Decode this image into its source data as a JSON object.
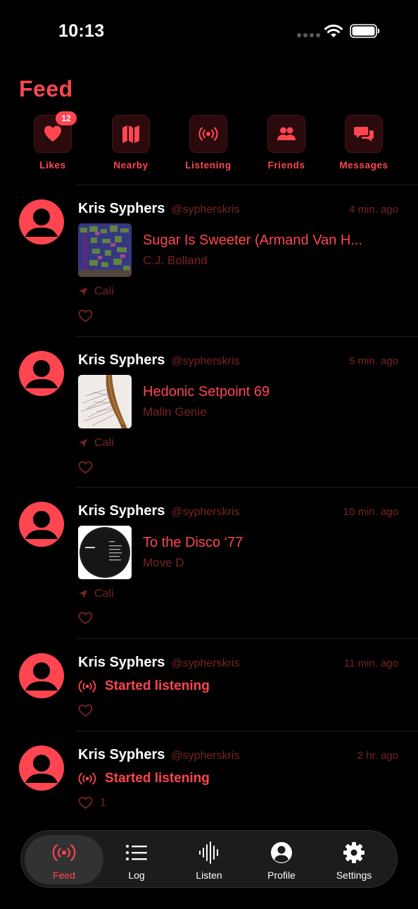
{
  "status_bar": {
    "time": "10:13"
  },
  "title": "Feed",
  "colors": {
    "accent": "#ff4650",
    "muted": "#7a2226",
    "background": "#000000"
  },
  "quick_actions": [
    {
      "label": "Likes",
      "icon": "heart-icon",
      "badge": "12"
    },
    {
      "label": "Nearby",
      "icon": "map-icon"
    },
    {
      "label": "Listening",
      "icon": "broadcast-icon"
    },
    {
      "label": "Friends",
      "icon": "people-icon"
    },
    {
      "label": "Messages",
      "icon": "chat-bubbles-icon"
    }
  ],
  "feed": [
    {
      "name": "Kris Syphers",
      "handle": "@sypherskris",
      "time": "4 min. ago",
      "track_title": "Sugar Is Sweeter (Armand Van H...",
      "artist": "C.J. Bolland",
      "location": "Cali"
    },
    {
      "name": "Kris Syphers",
      "handle": "@sypherskris",
      "time": "5 min. ago",
      "track_title": "Hedonic Setpoint 69",
      "artist": "Malin Genie",
      "location": "Cali"
    },
    {
      "name": "Kris Syphers",
      "handle": "@sypherskris",
      "time": "10 min. ago",
      "track_title": "To the Disco ‘77",
      "artist": "Move D",
      "location": "Cali"
    },
    {
      "name": "Kris Syphers",
      "handle": "@sypherskris",
      "time": "11 min. ago",
      "activity": "Started listening"
    },
    {
      "name": "Kris Syphers",
      "handle": "@sypherskris",
      "time": "2 hr. ago",
      "activity": "Started listening",
      "like_count": "1"
    }
  ],
  "tabs": [
    {
      "label": "Feed",
      "icon": "broadcast-icon",
      "active": true
    },
    {
      "label": "Log",
      "icon": "list-icon"
    },
    {
      "label": "Listen",
      "icon": "waveform-icon"
    },
    {
      "label": "Profile",
      "icon": "person-circle-icon"
    },
    {
      "label": "Settings",
      "icon": "gear-icon"
    }
  ]
}
